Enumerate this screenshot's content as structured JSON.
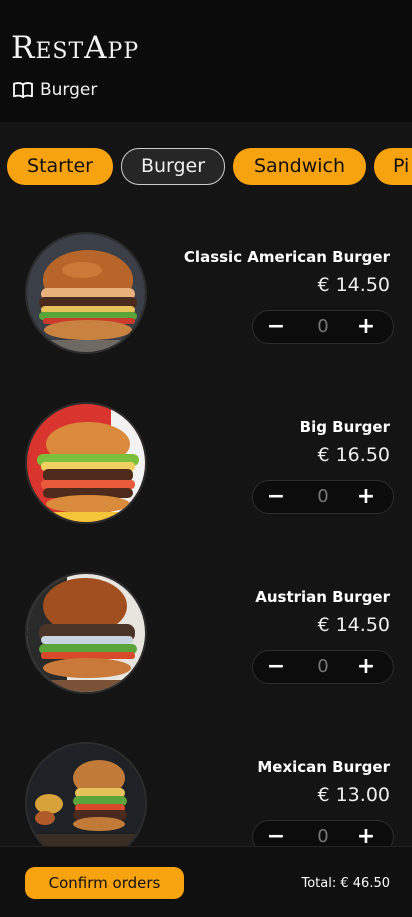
{
  "header": {
    "app_title": "RestApp",
    "breadcrumb_icon": "book-open-icon",
    "breadcrumb_label": "Burger"
  },
  "tabs": [
    {
      "label": "Starter",
      "active": false
    },
    {
      "label": "Burger",
      "active": true
    },
    {
      "label": "Sandwich",
      "active": false
    },
    {
      "label": "Pi",
      "active": false
    }
  ],
  "items": [
    {
      "name": "Classic American Burger",
      "price": "€ 14.50",
      "qty": "0",
      "minus": "−",
      "plus": "+"
    },
    {
      "name": "Big Burger",
      "price": "€ 16.50",
      "qty": "0",
      "minus": "−",
      "plus": "+"
    },
    {
      "name": "Austrian Burger",
      "price": "€ 14.50",
      "qty": "0",
      "minus": "−",
      "plus": "+"
    },
    {
      "name": "Mexican Burger",
      "price": "€ 13.00",
      "qty": "0",
      "minus": "−",
      "plus": "+"
    }
  ],
  "footer": {
    "confirm_label": "Confirm orders",
    "total_label": "Total: € 46.50"
  },
  "colors": {
    "accent": "#f7a20f",
    "background": "#141414",
    "header": "#0b0b0b"
  }
}
